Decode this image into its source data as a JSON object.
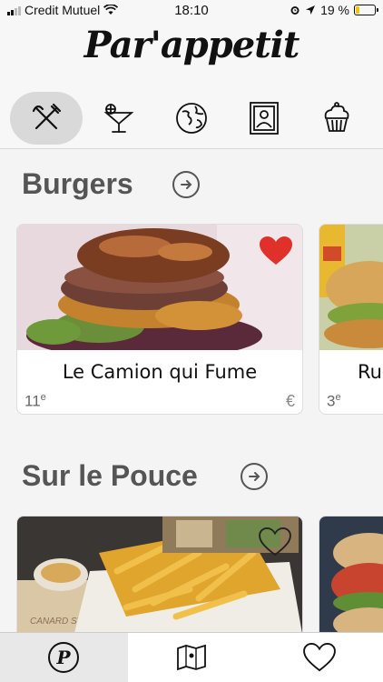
{
  "status_bar": {
    "carrier": "Credit Mutuel",
    "time": "18:10",
    "battery": "19 %",
    "battery_level": 0.19
  },
  "header": {
    "logo": "Par'appetit"
  },
  "categories": [
    {
      "icon": "utensils-icon",
      "active": true
    },
    {
      "icon": "cocktail-icon",
      "active": false
    },
    {
      "icon": "globe-icon",
      "active": false
    },
    {
      "icon": "portrait-frame-icon",
      "active": false
    },
    {
      "icon": "cupcake-icon",
      "active": false
    }
  ],
  "sections": [
    {
      "title": "Burgers",
      "cards": [
        {
          "name": "Le Camion qui Fume",
          "rank": "11",
          "rank_suffix": "e",
          "price": "€",
          "favorite": true
        },
        {
          "name": "Ru",
          "rank": "3",
          "rank_suffix": "e",
          "price": "",
          "favorite": false
        }
      ]
    },
    {
      "title": "Sur le Pouce",
      "cards": [
        {
          "name": "",
          "rank": "",
          "price": "",
          "favorite": false,
          "photo_text": "CANARD STREET"
        },
        {
          "name": "",
          "rank": "",
          "price": "",
          "favorite": false
        }
      ]
    }
  ],
  "tab_bar": {
    "tabs": [
      {
        "icon": "parappetit-logo-icon",
        "active": true
      },
      {
        "icon": "map-icon",
        "active": false
      },
      {
        "icon": "heart-icon",
        "active": false
      }
    ]
  },
  "colors": {
    "accent_heart": "#e0302a",
    "section_title": "#555555",
    "active_pill": "#d9d9d9"
  }
}
